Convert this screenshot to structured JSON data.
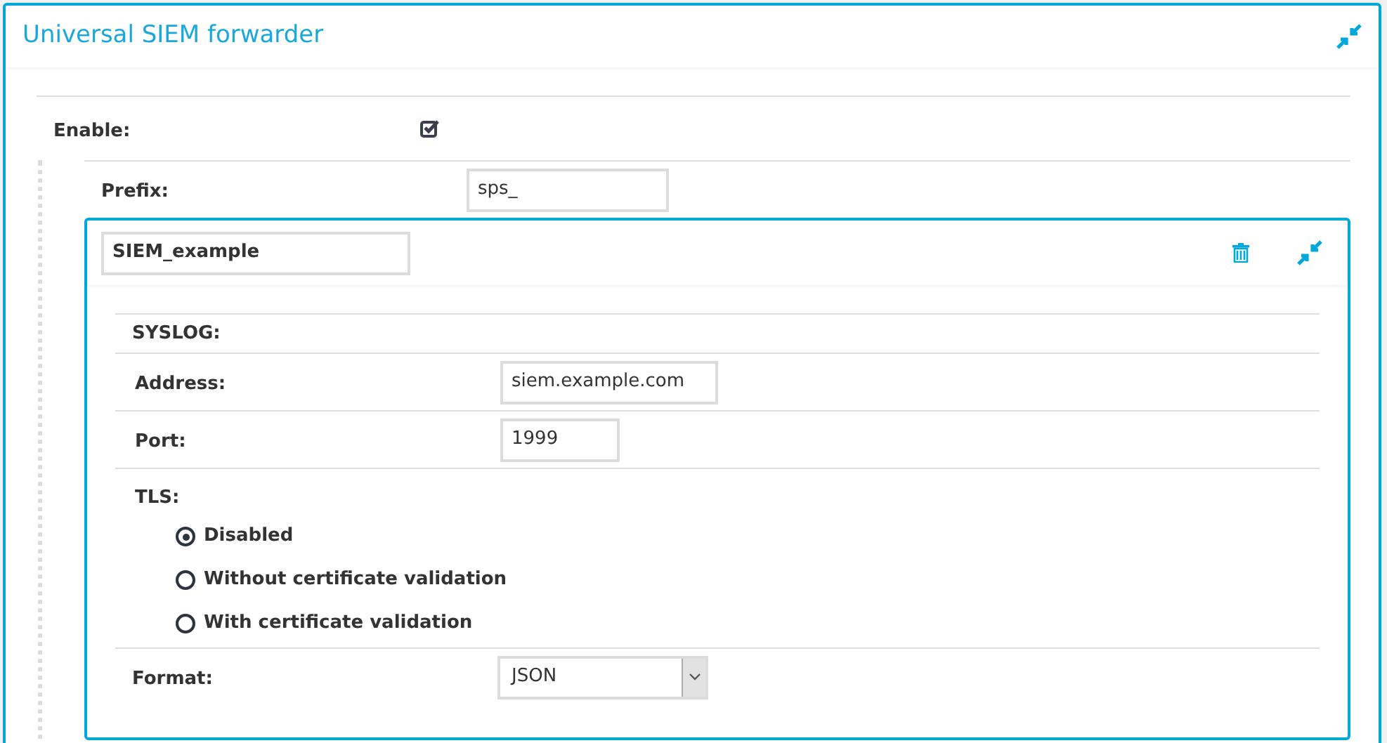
{
  "panel": {
    "title": "Universal SIEM forwarder"
  },
  "enable": {
    "label": "Enable:",
    "checked": true
  },
  "prefix": {
    "label": "Prefix:",
    "value": "sps_"
  },
  "forwarder": {
    "name": "SIEM_example",
    "section": "SYSLOG:",
    "address": {
      "label": "Address:",
      "value": "siem.example.com"
    },
    "port": {
      "label": "Port:",
      "value": "1999"
    },
    "tls": {
      "label": "TLS:",
      "options": [
        {
          "label": "Disabled",
          "selected": true
        },
        {
          "label": "Without certificate validation",
          "selected": false
        },
        {
          "label": "With certificate validation",
          "selected": false
        }
      ]
    },
    "format": {
      "label": "Format:",
      "value": "JSON"
    }
  }
}
